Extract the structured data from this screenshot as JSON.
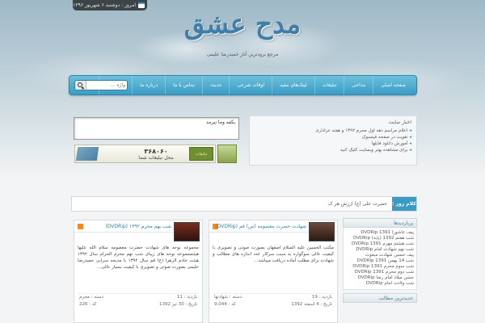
{
  "topbar": {
    "date": "امروز : دوشنبه ۶ شهریور ۱۳۹۶"
  },
  "header": {
    "logo": "مدح عشق",
    "tagline": "مرجع برودترین آثار حمیدرضا علیمی"
  },
  "nav": {
    "items": [
      "صفحه اصلی",
      "مداحی",
      "تبلیغات",
      "لینک‌های مفید",
      "اوقات شرعی",
      "حدیث",
      "تماس با ما",
      "درباره ما",
      "نظر شما"
    ],
    "search_placeholder": "واژه ..."
  },
  "news": {
    "title": "اخبار سایت",
    "items": [
      "اعلام مراسم دهه اول محرم ۱۳۹۲ و هفته عزاداری",
      "تقویت در صفحه فیسبوک",
      "آموزش دانلود فایلها",
      "برای مشاهده بهتر وبسایت کلیک کنید"
    ]
  },
  "poem_box": {
    "text": "یکفه وما نیرمد"
  },
  "ad": {
    "number": "۳۶۸۰۶۰",
    "line": "محل تبلیغات شما",
    "badge": "تبلیغات"
  },
  "ticker": {
    "label": "کلام روز :",
    "text": "حضرت علی (ع) ارزش هر ک"
  },
  "sidebar": {
    "popular_title": "پربازدیدها",
    "popular_items": [
      "پیف عاشورا 1391 DVDRip",
      "شب هفتم 1392 (پایه) DVDRip",
      "شب هشتم مهرم 1391 DVDRip",
      "شب نهم شهادت امام DVDRip",
      "پیف حسین شهادت مبعوت",
      "شب 14 بهمن 1391 DVDRip",
      "شب سوم محرم 1391 DVDRip",
      "شب دوم محرم 1391 DVDRip",
      "جشن میلاد امام رضا DVDRip",
      "شب ولادت امام DVDRip"
    ],
    "latest_title": "جدیدترین مطالب"
  },
  "posts": [
    {
      "title": "شب بهم محرم ۱۳۹۲ (DVDRip)",
      "text": "مجموعه نوحه های شهادت حضرت معصومه سلام الله علیها هیئتمجموعه نوحه های زیبای شب نهم محرم الحرام سال ۱۳۹۲ هیئت خادم الزهرا (ع) قم سال ۱۳۹۲ با مدیحه سرایی حمیدرضا علیمی بصورت صوتی و تصویری با کیفیت بسیار عالی...",
      "category_label": "دسته : محرم",
      "views_label": "بازدید : 11",
      "date_label": "تاریخ : 30 تیر 1392",
      "size_label": "کد : 226"
    },
    {
      "title": "شهادت حضرت معصومه (س) قم (DVDRip)",
      "text": "مکتب الحسین علیه السلام اصفهان بصورت صوتی و تصویری با کیفیت عالی سوگواره به سبب سرکار عدد اندازه های مطالب و شهادت برای مطلب آماده دریافت میباشد...",
      "category_label": "دسته : شهادتها",
      "views_label": "بازدید : 19",
      "date_label": "تاریخ : 4 اسفند 1392",
      "size_label": "کد : 9,044"
    }
  ]
}
